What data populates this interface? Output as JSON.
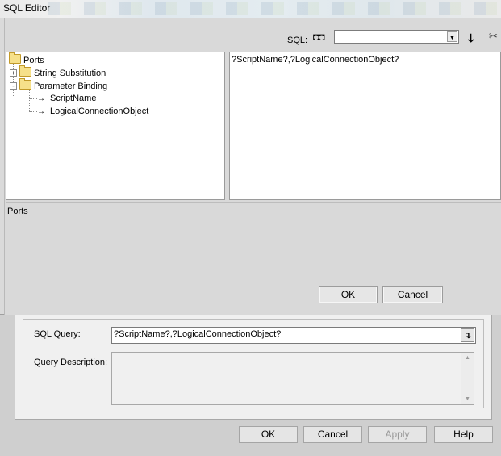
{
  "editor": {
    "title": "SQL Editor",
    "toolbar": {
      "sql_label": "SQL:",
      "sql_combo_value": "",
      "icons": [
        "binoculars-icon",
        "insert-arrow-icon",
        "cut-icon"
      ]
    },
    "tree": {
      "root": "Ports",
      "items": [
        {
          "label": "String Substitution",
          "expander": "+"
        },
        {
          "label": "Parameter Binding",
          "expander": "-"
        }
      ],
      "children": [
        "ScriptName",
        "LogicalConnectionObject"
      ]
    },
    "sql_text": "?ScriptName?,?LogicalConnectionObject?",
    "status_text": "Ports",
    "buttons": {
      "ok": "OK",
      "cancel": "Cancel"
    }
  },
  "parent_dialog": {
    "sql_query_label": "SQL Query:",
    "sql_query_value": "?ScriptName?,?LogicalConnectionObject?",
    "query_description_label": "Query Description:",
    "query_description_value": "",
    "buttons": {
      "ok": "OK",
      "cancel": "Cancel",
      "apply": "Apply",
      "help": "Help"
    }
  },
  "colors": {
    "window_bg": "#d9d9d9",
    "pane_bg": "#ffffff",
    "folder": "#f6e08a",
    "disabled_text": "#9a9a9a"
  }
}
